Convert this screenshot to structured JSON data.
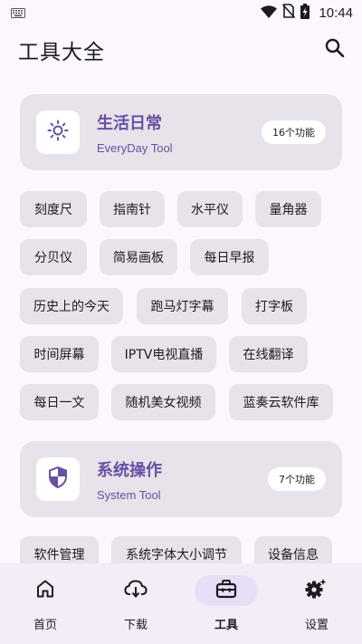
{
  "status_bar": {
    "time": "10:44",
    "icons": [
      "keyboard-icon",
      "wifi-icon",
      "no-sim-icon",
      "battery-charging-icon"
    ]
  },
  "app_bar": {
    "title": "工具大全",
    "search_icon": "search-icon"
  },
  "sections": [
    {
      "title": "生活日常",
      "subtitle": "EveryDay Tool",
      "count": "16个功能",
      "icon": "sun-icon",
      "tools": [
        "刻度尺",
        "指南针",
        "水平仪",
        "量角器",
        "分贝仪",
        "简易画板",
        "每日早报",
        "历史上的今天",
        "跑马灯字幕",
        "打字板",
        "时间屏幕",
        "IPTV电视直播",
        "在线翻译",
        "每日一文",
        "随机美女视频",
        "蓝奏云软件库"
      ]
    },
    {
      "title": "系统操作",
      "subtitle": "System Tool",
      "count": "7个功能",
      "icon": "shield-icon",
      "tools": [
        "软件管理",
        "系统字体大小调节",
        "设备信息"
      ]
    }
  ],
  "bottom_nav": {
    "items": [
      {
        "label": "首页",
        "icon": "home-icon",
        "active": false
      },
      {
        "label": "下载",
        "icon": "cloud-download-icon",
        "active": false
      },
      {
        "label": "工具",
        "icon": "toolbox-icon",
        "active": true
      },
      {
        "label": "设置",
        "icon": "settings-icon",
        "active": false
      }
    ]
  },
  "colors": {
    "background": "#FCF7FC",
    "card": "#E8E2EA",
    "accent": "#6750A4",
    "nav_background": "#F3EDF7",
    "nav_indicator": "#E8DEF8"
  }
}
